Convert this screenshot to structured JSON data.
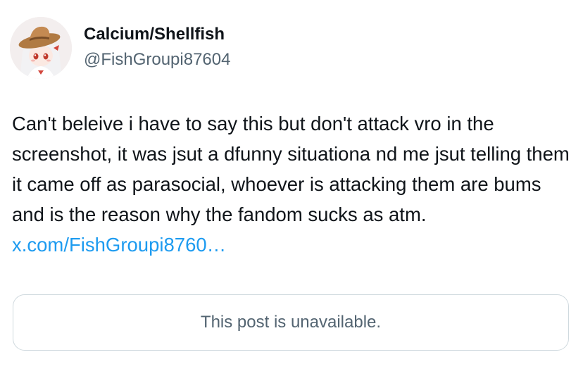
{
  "author": {
    "display_name": "Calcium/Shellfish",
    "handle": "@FishGroupi87604",
    "avatar_icon": "anime-avatar-icon"
  },
  "tweet": {
    "text": "Can't beleive i have to say this but don't attack vro in the screenshot, it was jsut a dfunny situationa nd me jsut telling them it came off as parasocial, whoever is attacking them are bums and is the reason why the fandom sucks as atm.",
    "link_text": "x.com/FishGroupi8760…"
  },
  "quoted_post": {
    "unavailable_text": "This post is unavailable."
  },
  "colors": {
    "text_primary": "#0f1419",
    "text_secondary": "#536471",
    "link": "#1d9bf0",
    "border": "#cfd9de"
  }
}
